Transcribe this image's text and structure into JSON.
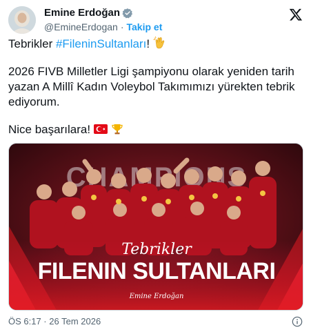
{
  "author": {
    "name": "Emine Erdoğan",
    "handle": "@EmineErdogan",
    "separator": "·",
    "follow_label": "Takip et"
  },
  "tweet": {
    "line1_prefix": "Tebrikler ",
    "hashtag": "#FileninSultanları",
    "line1_suffix": "!",
    "paragraph2": "2026 FIVB Milletler Ligi şampiyonu olarak yeniden tarih yazan A Millî Kadın Voleybol Takımımızı yürekten tebrik ediyorum.",
    "paragraph3": "Nice başarılara!"
  },
  "media": {
    "banner_text": "CHAMPIONS",
    "subtitle": "Tebrikler",
    "title": "Filenin Sultanları",
    "signature": "Emine Erdoğan"
  },
  "footer": {
    "timestamp": "ÖS 6:17 · 26 Tem 2026"
  },
  "icons": {
    "verified": "verified-badge-icon",
    "x_logo": "x-logo-icon",
    "info": "info-icon",
    "clap": "clapping-hands-icon",
    "flag": "turkey-flag-icon",
    "trophy": "trophy-icon"
  },
  "colors": {
    "link": "#1d9bf0",
    "text": "#0f1419",
    "muted": "#536471",
    "media_red": "#c8102e"
  }
}
